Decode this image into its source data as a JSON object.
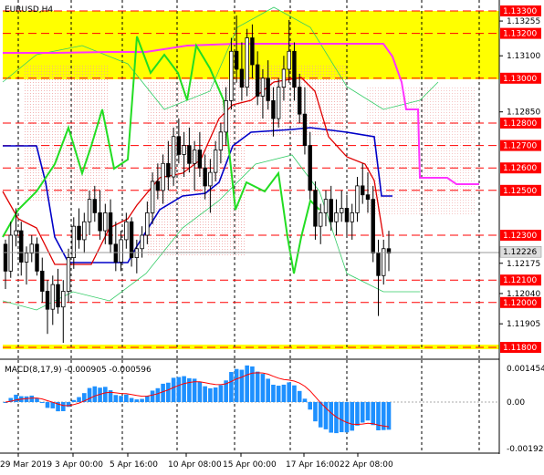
{
  "symbol_label": "EURUSD,H4",
  "macd_label": "MACD(8,17,9) -0.000905 -0.000596",
  "colors": {
    "zone": "#ffff00",
    "level_line": "#ff0000",
    "level_box": "#ff0000",
    "candle": "#000000",
    "blue_line": "#0000c8",
    "red_line": "#e00000",
    "green_line": "#22dd22",
    "magenta_line": "#ff33ff",
    "histogram": "#1e90ff",
    "signal": "#ff0000",
    "bands": "#33cc66"
  },
  "price_axis": {
    "plain_labels": [
      "1.13255",
      "1.13100",
      "1.12850",
      "1.12175",
      "1.12040",
      "1.11905"
    ],
    "boxed_labels": [
      "1.13300",
      "1.13200",
      "1.13000",
      "1.12800",
      "1.12700",
      "1.12600",
      "1.12500",
      "1.12300",
      "1.12100",
      "1.12000",
      "1.11800"
    ],
    "current_price": "1.12226"
  },
  "macd_axis": {
    "labels": [
      "0.001454",
      "0.00",
      "-0.001923"
    ]
  },
  "time_axis": {
    "labels": [
      "29 Mar 2019",
      "3 Apr 00:00",
      "5 Apr 16:00",
      "10 Apr 08:00",
      "15 Apr 00:00",
      "17 Apr 16:00",
      "22 Apr 08:00"
    ]
  },
  "chart_data": {
    "type": "candlestick",
    "symbol": "EURUSD",
    "timeframe": "H4",
    "y_range": [
      1.1174,
      1.1338
    ],
    "key_levels": [
      1.133,
      1.132,
      1.13,
      1.128,
      1.127,
      1.126,
      1.125,
      1.123,
      1.121,
      1.12,
      1.118
    ],
    "resistance_zones": [
      [
        1.13,
        1.133
      ]
    ],
    "support_zones": [
      [
        1.1178,
        1.118
      ]
    ],
    "current_price": 1.12226,
    "candles_ohlc": [
      [
        1.1226,
        1.1228,
        1.1206,
        1.1214
      ],
      [
        1.1214,
        1.1236,
        1.1211,
        1.123
      ],
      [
        1.123,
        1.1242,
        1.1225,
        1.1232
      ],
      [
        1.1232,
        1.1236,
        1.1212,
        1.1218
      ],
      [
        1.1218,
        1.1225,
        1.1208,
        1.1222
      ],
      [
        1.1222,
        1.123,
        1.1218,
        1.1226
      ],
      [
        1.1226,
        1.1229,
        1.1212,
        1.1214
      ],
      [
        1.1214,
        1.122,
        1.12,
        1.1205
      ],
      [
        1.1205,
        1.121,
        1.1186,
        1.1197
      ],
      [
        1.1197,
        1.1212,
        1.119,
        1.1208
      ],
      [
        1.1208,
        1.1215,
        1.1195,
        1.1198
      ],
      [
        1.1198,
        1.121,
        1.1182,
        1.1205
      ],
      [
        1.1205,
        1.1224,
        1.12,
        1.122
      ],
      [
        1.122,
        1.1238,
        1.1215,
        1.1234
      ],
      [
        1.1234,
        1.1242,
        1.1224,
        1.1228
      ],
      [
        1.1228,
        1.124,
        1.1222,
        1.1236
      ],
      [
        1.1236,
        1.125,
        1.123,
        1.1246
      ],
      [
        1.1246,
        1.1252,
        1.1236,
        1.124
      ],
      [
        1.124,
        1.125,
        1.1228,
        1.1232
      ],
      [
        1.1232,
        1.1244,
        1.1226,
        1.124
      ],
      [
        1.124,
        1.1246,
        1.1222,
        1.1226
      ],
      [
        1.1226,
        1.1236,
        1.1214,
        1.1218
      ],
      [
        1.1218,
        1.1232,
        1.1214,
        1.1228
      ],
      [
        1.1228,
        1.124,
        1.1224,
        1.1236
      ],
      [
        1.1236,
        1.1238,
        1.1216,
        1.122
      ],
      [
        1.122,
        1.1228,
        1.1213,
        1.1224
      ],
      [
        1.1224,
        1.1234,
        1.122,
        1.123
      ],
      [
        1.123,
        1.1245,
        1.1226,
        1.124
      ],
      [
        1.124,
        1.1258,
        1.1235,
        1.1254
      ],
      [
        1.1254,
        1.1262,
        1.1246,
        1.125
      ],
      [
        1.125,
        1.1266,
        1.1244,
        1.1262
      ],
      [
        1.1262,
        1.1272,
        1.125,
        1.1256
      ],
      [
        1.1256,
        1.1278,
        1.1252,
        1.1274
      ],
      [
        1.1274,
        1.1282,
        1.1262,
        1.1266
      ],
      [
        1.1266,
        1.1276,
        1.1256,
        1.127
      ],
      [
        1.127,
        1.1278,
        1.1258,
        1.1262
      ],
      [
        1.1262,
        1.1272,
        1.125,
        1.1268
      ],
      [
        1.1268,
        1.1276,
        1.1256,
        1.126
      ],
      [
        1.126,
        1.1266,
        1.1246,
        1.1252
      ],
      [
        1.1252,
        1.1264,
        1.124,
        1.1258
      ],
      [
        1.1258,
        1.1272,
        1.1254,
        1.1268
      ],
      [
        1.1268,
        1.128,
        1.1262,
        1.1276
      ],
      [
        1.1276,
        1.1296,
        1.127,
        1.129
      ],
      [
        1.129,
        1.1318,
        1.1286,
        1.1312
      ],
      [
        1.1312,
        1.1328,
        1.1298,
        1.1304
      ],
      [
        1.1304,
        1.1316,
        1.129,
        1.1296
      ],
      [
        1.1296,
        1.1322,
        1.1292,
        1.1318
      ],
      [
        1.1318,
        1.1324,
        1.13,
        1.1306
      ],
      [
        1.1306,
        1.1312,
        1.1288,
        1.1292
      ],
      [
        1.1292,
        1.1304,
        1.1282,
        1.13
      ],
      [
        1.13,
        1.1308,
        1.1286,
        1.129
      ],
      [
        1.129,
        1.1296,
        1.1274,
        1.1282
      ],
      [
        1.1282,
        1.13,
        1.1278,
        1.1296
      ],
      [
        1.1296,
        1.131,
        1.129,
        1.1304
      ],
      [
        1.1304,
        1.1326,
        1.1298,
        1.1312
      ],
      [
        1.1312,
        1.1316,
        1.129,
        1.1296
      ],
      [
        1.1296,
        1.1302,
        1.128,
        1.1284
      ],
      [
        1.1284,
        1.1296,
        1.1266,
        1.127
      ],
      [
        1.127,
        1.1276,
        1.1246,
        1.125
      ],
      [
        1.125,
        1.1254,
        1.1228,
        1.1234
      ],
      [
        1.1234,
        1.1244,
        1.1226,
        1.124
      ],
      [
        1.124,
        1.125,
        1.1234,
        1.1246
      ],
      [
        1.1246,
        1.1252,
        1.1232,
        1.1236
      ],
      [
        1.1236,
        1.1246,
        1.123,
        1.124
      ],
      [
        1.124,
        1.125,
        1.1236,
        1.1242
      ],
      [
        1.1242,
        1.1248,
        1.123,
        1.1236
      ],
      [
        1.1236,
        1.1244,
        1.1228,
        1.124
      ],
      [
        1.124,
        1.1256,
        1.1236,
        1.1252
      ],
      [
        1.1252,
        1.1262,
        1.1244,
        1.1248
      ],
      [
        1.1248,
        1.1258,
        1.124,
        1.1246
      ],
      [
        1.1246,
        1.1252,
        1.1218,
        1.1222
      ],
      [
        1.1222,
        1.1228,
        1.1194,
        1.1212
      ],
      [
        1.1212,
        1.1228,
        1.1208,
        1.1224
      ],
      [
        1.1224,
        1.1232,
        1.1214,
        1.1222
      ]
    ],
    "indicators": {
      "macd": {
        "params": [
          8,
          17,
          9
        ],
        "main": -0.000905,
        "signal": -0.000596,
        "axis_max": 0.001454,
        "axis_min": -0.001923
      }
    }
  }
}
